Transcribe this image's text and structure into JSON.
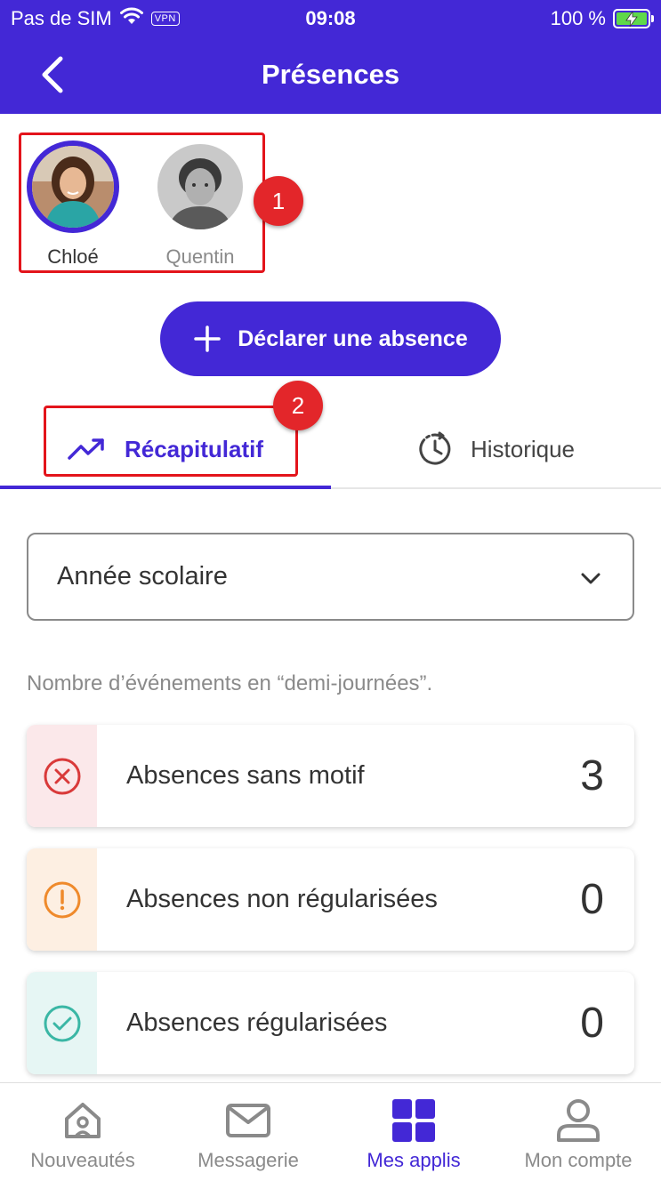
{
  "status_bar": {
    "carrier": "Pas de SIM",
    "vpn": "VPN",
    "time": "09:08",
    "battery": "100 %"
  },
  "header": {
    "title": "Présences"
  },
  "children": [
    {
      "name": "Chloé"
    },
    {
      "name": "Quentin"
    }
  ],
  "annotations": [
    "1",
    "2"
  ],
  "declare_button": {
    "label": "Déclarer une absence"
  },
  "tabs": [
    {
      "label": "Récapitulatif",
      "icon": "trending-up-icon"
    },
    {
      "label": "Historique",
      "icon": "history-icon"
    }
  ],
  "period_select": {
    "value": "Année scolaire"
  },
  "note": "Nombre d’événements en “demi-journées”.",
  "cards": [
    {
      "label": "Absences sans motif",
      "count": "3",
      "icon": "x-circle-icon",
      "color": "#d93a3a",
      "bg": "#fbe8ea"
    },
    {
      "label": "Absences non régularisées",
      "count": "0",
      "icon": "alert-circle-icon",
      "color": "#ef8a2b",
      "bg": "#fdefe2"
    },
    {
      "label": "Absences régularisées",
      "count": "0",
      "icon": "check-circle-icon",
      "color": "#3bb7a5",
      "bg": "#e6f6f4"
    }
  ],
  "bottom_nav": [
    {
      "label": "Nouveautés",
      "icon": "home-icon"
    },
    {
      "label": "Messagerie",
      "icon": "mail-icon"
    },
    {
      "label": "Mes applis",
      "icon": "apps-grid-icon",
      "active": true
    },
    {
      "label": "Mon compte",
      "icon": "user-icon"
    }
  ],
  "colors": {
    "primary": "#4328d6",
    "annotation": "#e3141b"
  }
}
